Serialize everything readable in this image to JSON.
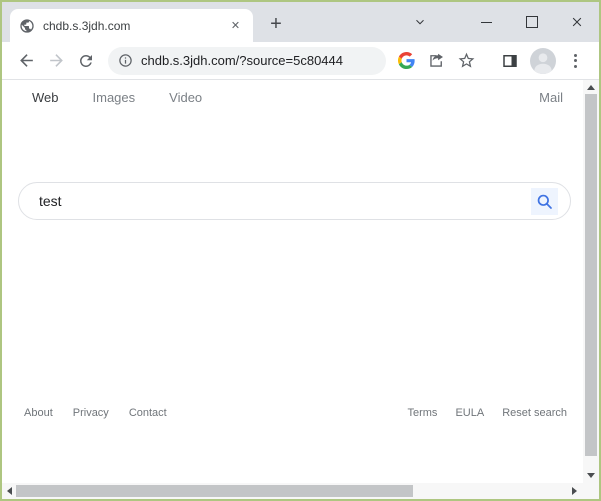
{
  "colors": {
    "frame_green": "#aec681",
    "accent_blue": "#4285f4",
    "tabstrip_gray": "#dee1e6",
    "icon_gray": "#5f6368",
    "link_gray": "#70757a"
  },
  "tab_strip": {
    "tab_title": "chdb.s.3jdh.com",
    "close_tab_glyph": "✕",
    "new_tab_glyph": "+"
  },
  "toolbar": {
    "url": "chdb.s.3jdh.com/?source=5c80444"
  },
  "page": {
    "nav": {
      "items": [
        {
          "label": "Web",
          "active": true
        },
        {
          "label": "Images",
          "active": false
        },
        {
          "label": "Video",
          "active": false
        }
      ],
      "mail": "Mail"
    },
    "search": {
      "value": "test"
    },
    "footer": {
      "left": [
        "About",
        "Privacy",
        "Contact"
      ],
      "right": [
        "Terms",
        "EULA",
        "Reset search"
      ]
    }
  }
}
